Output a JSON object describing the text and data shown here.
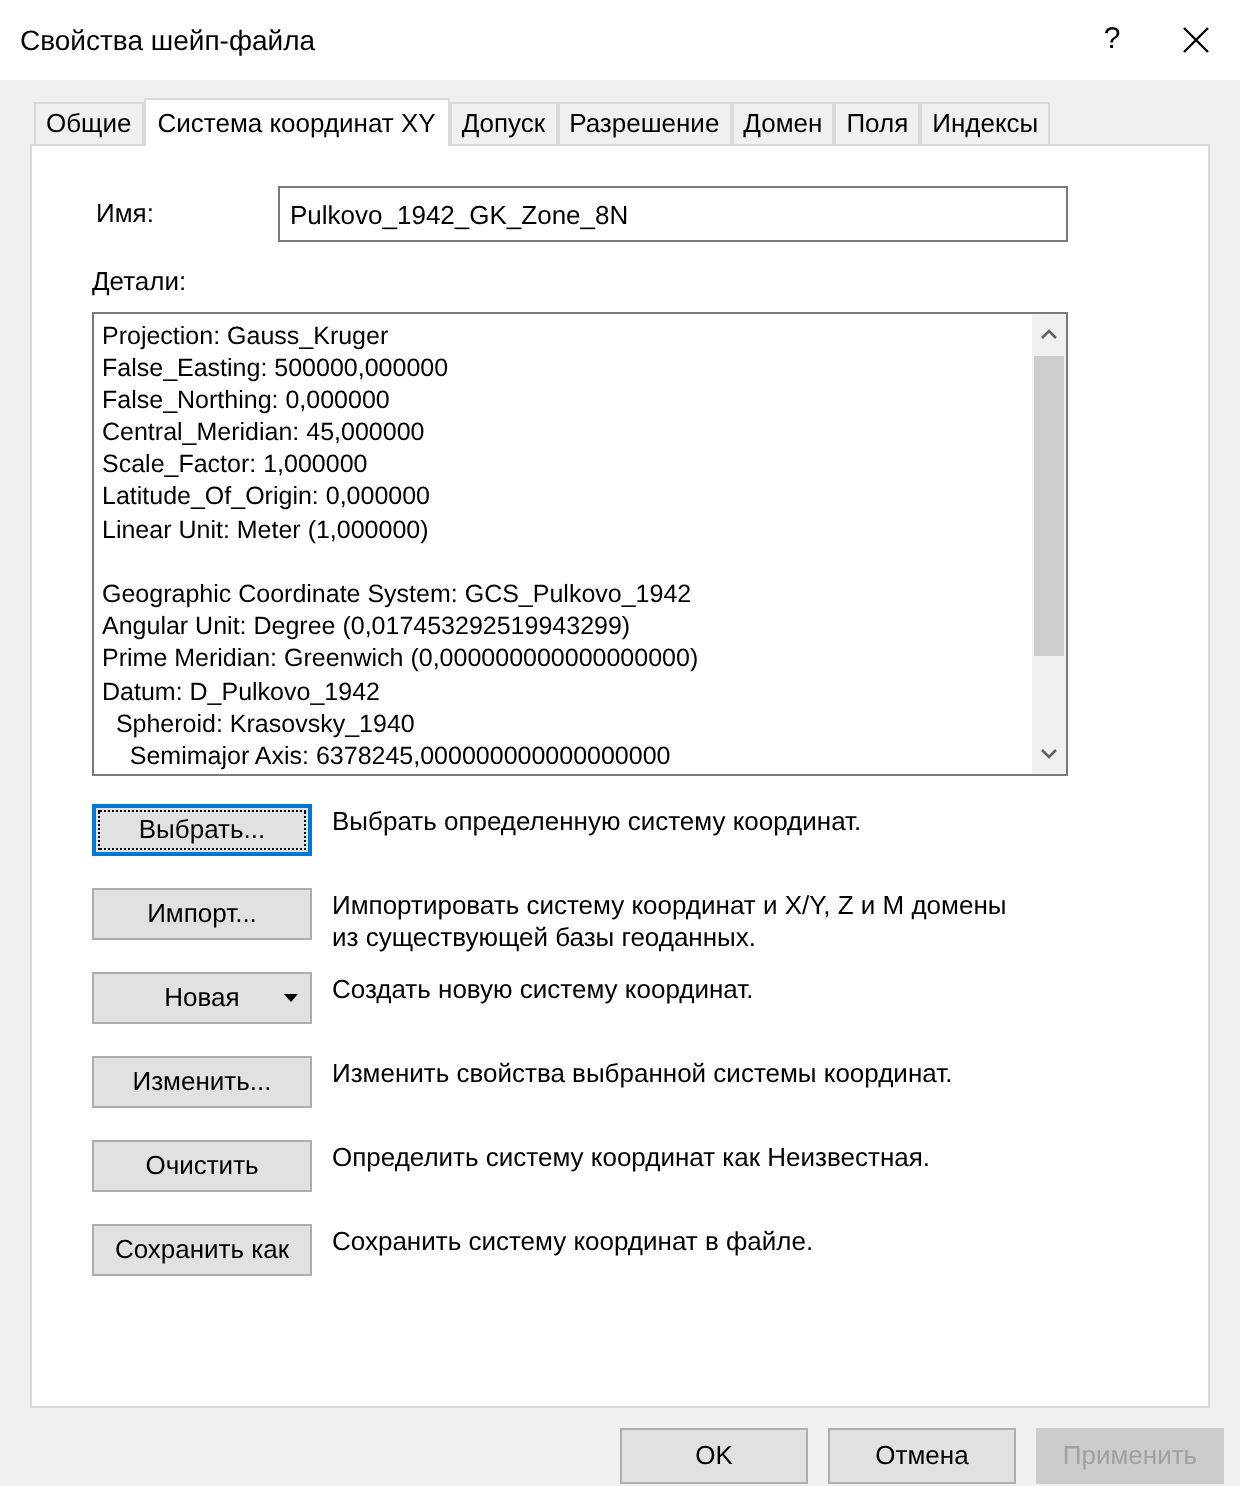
{
  "window": {
    "title": "Свойства шейп-файла",
    "help": "?"
  },
  "tabs": [
    {
      "label": "Общие",
      "selected": false
    },
    {
      "label": "Система координат XY",
      "selected": true
    },
    {
      "label": "Допуск",
      "selected": false
    },
    {
      "label": "Разрешение",
      "selected": false
    },
    {
      "label": "Домен",
      "selected": false
    },
    {
      "label": "Поля",
      "selected": false
    },
    {
      "label": "Индексы",
      "selected": false
    }
  ],
  "name_field": {
    "label": "Имя:",
    "value": "Pulkovo_1942_GK_Zone_8N"
  },
  "details": {
    "label": "Детали:",
    "groups": [
      [
        "Projection: Gauss_Kruger",
        "False_Easting: 500000,000000",
        "False_Northing: 0,000000",
        "Central_Meridian: 45,000000",
        "Scale_Factor: 1,000000",
        "Latitude_Of_Origin: 0,000000",
        "Linear Unit: Meter (1,000000)"
      ],
      [
        "Geographic Coordinate System: GCS_Pulkovo_1942",
        "Angular Unit: Degree (0,017453292519943299)",
        "Prime Meridian: Greenwich (0,000000000000000000)",
        "Datum: D_Pulkovo_1942",
        "  Spheroid: Krasovsky_1940",
        "    Semimajor Axis: 6378245,000000000000000000"
      ]
    ]
  },
  "actions": [
    {
      "button": "Выбрать...",
      "description": "Выбрать определенную систему координат.",
      "focused": true,
      "dropdown": false
    },
    {
      "button": "Импорт...",
      "description": "Импортировать систему координат и X/Y, Z и M домены из существующей базы геоданных.",
      "focused": false,
      "dropdown": false
    },
    {
      "button": "Новая",
      "description": "Создать новую систему координат.",
      "focused": false,
      "dropdown": true
    },
    {
      "button": "Изменить...",
      "description": "Изменить свойства выбранной системы координат.",
      "focused": false,
      "dropdown": false
    },
    {
      "button": "Очистить",
      "description": "Определить систему координат как Неизвестная.",
      "focused": false,
      "dropdown": false
    },
    {
      "button": "Сохранить как",
      "description": "Сохранить систему координат в файле.",
      "focused": false,
      "dropdown": false
    }
  ],
  "footer_buttons": [
    {
      "label": "OK",
      "disabled": false
    },
    {
      "label": "Отмена",
      "disabled": false
    },
    {
      "label": "Применить",
      "disabled": true
    }
  ]
}
